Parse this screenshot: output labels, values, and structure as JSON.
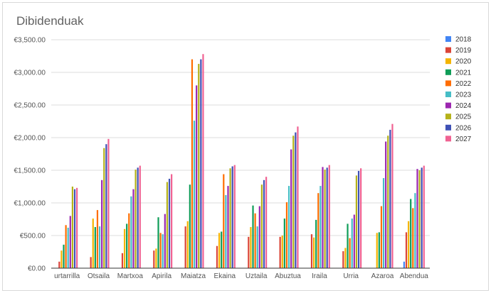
{
  "chart_data": {
    "type": "bar",
    "title": "Dibidenduak",
    "xlabel": "",
    "ylabel": "",
    "ylim": [
      0,
      3500
    ],
    "yticks": [
      "€0.00",
      "€500.00",
      "€1,000.00",
      "€1,500.00",
      "€2,000.00",
      "€2,500.00",
      "€3,000.00",
      "€3,500.00"
    ],
    "grid": true,
    "legend_position": "right",
    "categories": [
      "urtarrilla",
      "Otsaila",
      "Martxoa",
      "Apirila",
      "Maiatza",
      "Ekaina",
      "Uztaila",
      "Abuztua",
      "Iraila",
      "Urria",
      "Azaroa",
      "Abendua"
    ],
    "series": [
      {
        "name": "2018",
        "color": "#4285f4",
        "values": [
          0,
          0,
          0,
          0,
          0,
          0,
          0,
          0,
          0,
          0,
          0,
          100
        ]
      },
      {
        "name": "2019",
        "color": "#db4437",
        "values": [
          100,
          170,
          230,
          270,
          640,
          340,
          480,
          480,
          520,
          260,
          0,
          550
        ]
      },
      {
        "name": "2020",
        "color": "#f4b400",
        "values": [
          270,
          760,
          600,
          300,
          720,
          540,
          630,
          500,
          470,
          310,
          540,
          720
        ]
      },
      {
        "name": "2021",
        "color": "#0f9d58",
        "values": [
          360,
          630,
          680,
          780,
          1280,
          560,
          960,
          760,
          740,
          680,
          550,
          1060
        ]
      },
      {
        "name": "2022",
        "color": "#ff6d01",
        "values": [
          660,
          890,
          840,
          540,
          3200,
          1440,
          840,
          1010,
          1150,
          460,
          950,
          920
        ]
      },
      {
        "name": "2023",
        "color": "#46bdc6",
        "values": [
          620,
          640,
          1100,
          520,
          2260,
          1120,
          640,
          1260,
          1260,
          760,
          1380,
          1150
        ]
      },
      {
        "name": "2024",
        "color": "#9c27b0",
        "values": [
          800,
          1350,
          1210,
          830,
          2800,
          1260,
          950,
          1820,
          1550,
          820,
          1940,
          1520
        ]
      },
      {
        "name": "2025",
        "color": "#b5b21a",
        "values": [
          1250,
          1840,
          1510,
          1320,
          3130,
          1530,
          1280,
          2030,
          1510,
          1420,
          2030,
          1500
        ]
      },
      {
        "name": "2026",
        "color": "#3f51b5",
        "values": [
          1210,
          1900,
          1540,
          1370,
          3200,
          1560,
          1350,
          2080,
          1540,
          1490,
          2120,
          1540
        ]
      },
      {
        "name": "2027",
        "color": "#f06292",
        "values": [
          1230,
          1980,
          1570,
          1440,
          3280,
          1580,
          1400,
          2170,
          1580,
          1530,
          2210,
          1570
        ]
      }
    ]
  }
}
